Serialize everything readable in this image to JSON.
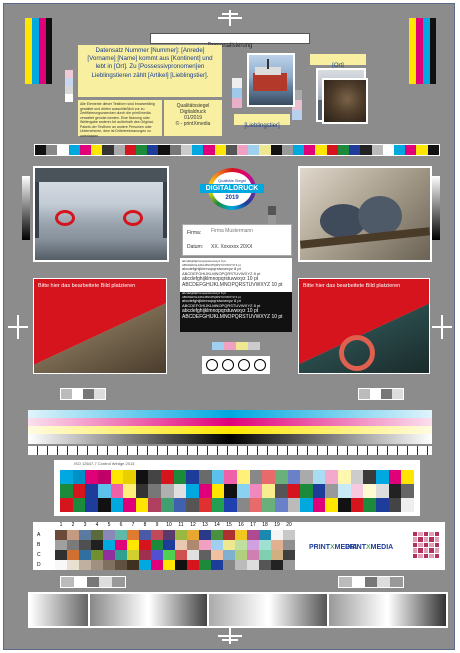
{
  "top": {
    "personalisierung": "Personalisierung",
    "datensatz_text": "Datensatz Nummer [Nummer]: [Anrede] [Vorname] [Name] kommt aus [Kontinent] und lebt in [Ort]. Zu [Possessivpronomen]en Lieblingstieren zählt [Artikel] [Lieblingstier].",
    "ort_placeholder": "[Ort]",
    "lieblingstier_placeholder": "[Lieblingstier]",
    "small_note": "Alle Elemente dieser Testform sind browserfähig gestaltet und dürfen ausschließlich zur zu Zertifizierungszwecken durch die printXmedia verwaltet genutzt werden. Eine Nutzung oder Weitergabe anderer Art außerhalb des Original-Pakets der Testform an andere Personen oder Unternehmen, dem ist Drittvereinbarungen zu unterlassen.",
    "seal_lines": [
      "Qualitätssiegel",
      "Digitaldruck",
      "01/2019",
      "© - printXmedia"
    ]
  },
  "seal_badge": {
    "line1": "Qualitäts Siegel",
    "line2": "DIGITALDRUCK",
    "line3": "2019"
  },
  "form": {
    "firma_label": "Firma:",
    "firma_value": "Firma Mustermann",
    "datum_label": "Datum:",
    "datum_value": "XX. Xxxxxxx 20XX"
  },
  "type_samples": [
    "abcdefghijklmnopqrstuvwxyz 6 pt",
    "ABCDEFGHIJKLMNOPQRSTUVWXYZ 6 pt",
    "abcdefghijklmnopqrstuvwxyz 8 pt",
    "ABCDEFGHIJKLMNOPQRSTUVWXYZ 8 pt",
    "abcdefghijklmnopqrstuvwxyz 10 pt",
    "ABCDEFGHIJKLMNOPQRSTUVWXYZ 10 pt"
  ],
  "type_samples_inverse": [
    "abcdefghijklmnopqrstuvwxyz 6 pt",
    "ABCDEFGHIJKLMNOPQRSTUVWXYZ 6 pt",
    "abcdefghijklmnopqrstuvwxyz 8 pt",
    "ABCDEFGHIJKLMNOPQRSTUVWXYZ 8 pt",
    "abcdefghijklmnopqrstuvwxyz 10 pt",
    "ABCDEFGHIJKLMNOPQRSTUVWXYZ 10 pt"
  ],
  "placeholder_left": "Bitte hier das bearbeitete Bild platzieren",
  "placeholder_right": "Bitte hier das bearbeitete Bild platzieren",
  "control_strip_label": "ISO 12647-7 Control Wedge 2013",
  "grid_columns": [
    "1",
    "2",
    "3",
    "4",
    "5",
    "6",
    "7",
    "8",
    "9",
    "10",
    "11",
    "12",
    "13",
    "14",
    "15",
    "16",
    "17",
    "18",
    "19",
    "20"
  ],
  "grid_rows": [
    "A",
    "B",
    "C",
    "D"
  ],
  "logos": {
    "print": "PRINT",
    "media": "MEDIA"
  },
  "colors": {
    "sheet": "#8c8c8c",
    "yellow_panel": "#f8f0a0",
    "red": "#d6141e",
    "cyan": "#00a8e0",
    "magenta": "#e0007a",
    "yellow": "#ffe600",
    "black": "#111111"
  }
}
